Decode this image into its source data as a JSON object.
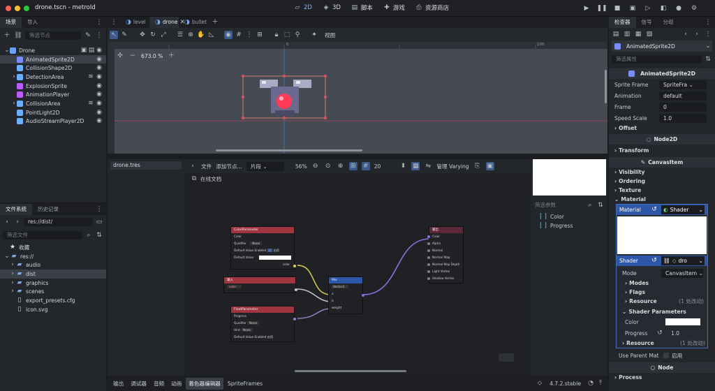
{
  "window": {
    "title": "drone.tscn - metroId"
  },
  "main_bar": {
    "items": [
      {
        "label": "2D",
        "active": true
      },
      {
        "label": "3D"
      },
      {
        "label": "脚本"
      },
      {
        "label": "游戏"
      },
      {
        "label": "资源商店"
      }
    ]
  },
  "scene_dock": {
    "tabs": [
      "场景",
      "导入"
    ],
    "filter_placeholder": "筛选节点",
    "nodes": [
      {
        "label": "Drone",
        "color": "#6aa0ff",
        "indent": 0,
        "selected": false
      },
      {
        "label": "AnimatedSprite2D",
        "color": "#7b8cff",
        "indent": 1,
        "selected": true
      },
      {
        "label": "CollisionShape2D",
        "color": "#6ab0ff",
        "indent": 1,
        "selected": false
      },
      {
        "label": "DetectionArea",
        "color": "#6ab0ff",
        "indent": 1,
        "selected": false
      },
      {
        "label": "ExplosionSprite",
        "color": "#c05cff",
        "indent": 1,
        "selected": false
      },
      {
        "label": "AnimationPlayer",
        "color": "#c05cff",
        "indent": 1,
        "selected": false
      },
      {
        "label": "CollisionArea",
        "color": "#6ab0ff",
        "indent": 1,
        "selected": false
      },
      {
        "label": "PointLight2D",
        "color": "#6ab0ff",
        "indent": 1,
        "selected": false
      },
      {
        "label": "AudioStreamPlayer2D",
        "color": "#6ab0ff",
        "indent": 1,
        "selected": false
      }
    ]
  },
  "fs_dock": {
    "tabs": [
      "文件系统",
      "历史记录"
    ],
    "path": "res://dist/",
    "filter_placeholder": "筛选文件",
    "favorites_label": "收藏",
    "items": [
      {
        "label": "res://",
        "indent": 0,
        "type": "folder",
        "selected": false
      },
      {
        "label": "audio",
        "indent": 1,
        "type": "folder",
        "selected": false
      },
      {
        "label": "dist",
        "indent": 1,
        "type": "folder",
        "selected": true
      },
      {
        "label": "graphics",
        "indent": 1,
        "type": "folder",
        "selected": false
      },
      {
        "label": "scenes",
        "indent": 1,
        "type": "folder",
        "selected": false
      },
      {
        "label": "export_presets.cfg",
        "indent": 1,
        "type": "file",
        "selected": false
      },
      {
        "label": "icon.svg",
        "indent": 1,
        "type": "file",
        "selected": false
      }
    ]
  },
  "editor_tabs": [
    {
      "label": "level"
    },
    {
      "label": "drone",
      "active": true
    },
    {
      "label": "bullet"
    }
  ],
  "viewport": {
    "view_label": "视图",
    "zoom": "673.0 %",
    "ruler": [
      "0",
      "100"
    ]
  },
  "shader_editor": {
    "file": "drone.tres",
    "toolbar": {
      "file": "文件",
      "add_node": "添加节点...",
      "type": "片段",
      "zoom": "56%",
      "snap": "20",
      "varyings": "管理 Varying"
    },
    "docs": "在线文档",
    "graph_nodes": {
      "color_param": {
        "title": "ColorParameter",
        "rows": [
          "Color",
          "Qualifier",
          "None",
          "Default Value Enabled",
          "启用",
          "Default Value"
        ],
        "port": "color"
      },
      "input": {
        "title": "输入",
        "value": "color"
      },
      "float_param": {
        "title": "FloatParameter",
        "rows": [
          "Progress",
          "Qualifier",
          "None",
          "Hint",
          "None",
          "Default Value Enabled",
          "启用"
        ]
      },
      "mix": {
        "title": "Mix",
        "type": "Vector3",
        "rows": [
          "a",
          "b",
          "weight"
        ]
      },
      "output": {
        "title": "输出",
        "rows": [
          "Color",
          "Alpha",
          "Normal",
          "Normal Map",
          "Normal Map Depth",
          "Light Vertex",
          "Shadow Vertex"
        ]
      }
    }
  },
  "params": {
    "filter": "筛选参数",
    "items": [
      "Color",
      "Progress"
    ]
  },
  "bottom": {
    "tabs": [
      "输出",
      "调试器",
      "音频",
      "动画",
      "着色器编辑器",
      "SpriteFrames"
    ],
    "active_tab": "着色器编辑器",
    "version": "4.7.2.stable"
  },
  "inspector": {
    "tabs": [
      "检查器",
      "信号",
      "分组"
    ],
    "node": "AnimatedSprite2D",
    "filter_placeholder": "筛选属性",
    "class_header": "AnimatedSprite2D",
    "props": {
      "sprite_frames": "Sprite Frame",
      "sprite_frames_val": "SpriteFra",
      "animation": "Animation",
      "animation_val": "default",
      "frame": "Frame",
      "frame_val": "0",
      "speed": "Speed Scale",
      "speed_val": "1.0"
    },
    "sections": {
      "offset": "Offset",
      "node2d": "Node2D",
      "transform": "Transform",
      "canvasitem": "CanvasItem",
      "visibility": "Visibility",
      "ordering": "Ordering",
      "texture": "Texture",
      "material": "Material"
    },
    "material": {
      "label": "Material",
      "value": "Shader",
      "shader_label": "Shader",
      "shader_val": "dro",
      "mode_label": "Mode",
      "mode_val": "CanvasItem",
      "modes": "Modes",
      "flags": "Flags",
      "resource": "Resource",
      "changed": "(1 处改动)",
      "params": "Shader Parameters",
      "color": "Color",
      "progress": "Progress",
      "progress_val": "1.0",
      "resource2": "Resource",
      "changed2": "(1 处改动)"
    },
    "use_parent": "Use Parent Mat",
    "enable": "启用",
    "node_header": "Node",
    "process": "Process"
  },
  "colors": {
    "accent": "#4d8df6",
    "selection": "#3a3f48",
    "param_header": "#a0353f",
    "mix_header": "#2f57a8",
    "output_header": "#5a2838"
  }
}
